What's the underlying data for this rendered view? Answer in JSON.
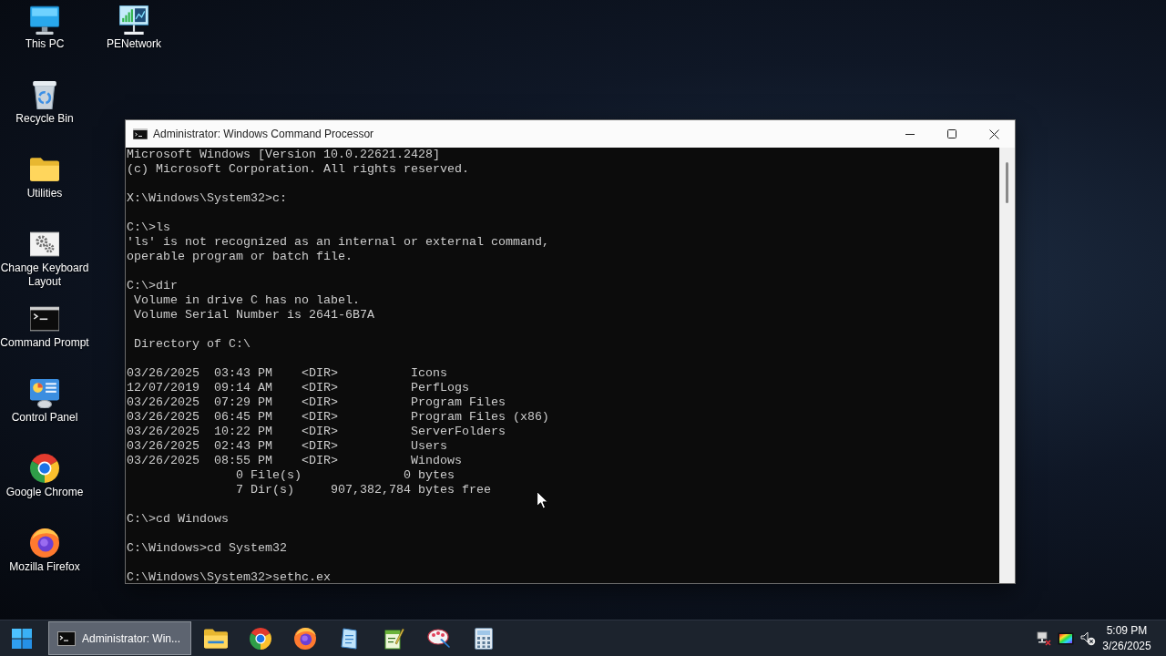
{
  "desktop": {
    "icons": [
      {
        "label": "This PC",
        "kind": "monitor"
      },
      {
        "label": "Recycle Bin",
        "kind": "recycle-bin"
      },
      {
        "label": "Utilities",
        "kind": "folder"
      },
      {
        "label": "Change Keyboard Layout",
        "kind": "gears"
      },
      {
        "label": "Command Prompt",
        "kind": "console"
      },
      {
        "label": "Control Panel",
        "kind": "control-panel"
      },
      {
        "label": "Google Chrome",
        "kind": "chrome"
      },
      {
        "label": "Mozilla Firefox",
        "kind": "firefox"
      },
      {
        "label": "PENetwork",
        "kind": "network"
      }
    ]
  },
  "window": {
    "title": "Administrator: Windows Command Processor",
    "console": {
      "blocks": [
        {
          "kind": "lines",
          "lines": [
            "Microsoft Windows [Version 10.0.22621.2428]",
            "(c) Microsoft Corporation. All rights reserved."
          ]
        },
        {
          "kind": "lines",
          "lines": [
            "X:\\Windows\\System32>c:"
          ]
        },
        {
          "kind": "lines",
          "lines": [
            "C:\\>ls",
            "'ls' is not recognized as an internal or external command,",
            "operable program or batch file."
          ]
        },
        {
          "kind": "lines",
          "lines": [
            "C:\\>dir",
            " Volume in drive C has no label.",
            " Volume Serial Number is 2641-6B7A"
          ]
        },
        {
          "kind": "lines",
          "lines": [
            " Directory of C:\\"
          ]
        },
        {
          "kind": "listing",
          "entries": [
            {
              "date": "03/26/2025",
              "time": "03:43 PM",
              "type": "<DIR>",
              "name": "Icons"
            },
            {
              "date": "12/07/2019",
              "time": "09:14 AM",
              "type": "<DIR>",
              "name": "PerfLogs"
            },
            {
              "date": "03/26/2025",
              "time": "07:29 PM",
              "type": "<DIR>",
              "name": "Program Files"
            },
            {
              "date": "03/26/2025",
              "time": "06:45 PM",
              "type": "<DIR>",
              "name": "Program Files (x86)"
            },
            {
              "date": "03/26/2025",
              "time": "10:22 PM",
              "type": "<DIR>",
              "name": "ServerFolders"
            },
            {
              "date": "03/26/2025",
              "time": "02:43 PM",
              "type": "<DIR>",
              "name": "Users"
            },
            {
              "date": "03/26/2025",
              "time": "08:55 PM",
              "type": "<DIR>",
              "name": "Windows"
            }
          ],
          "summary": [
            {
              "count": "0 File(s)",
              "total": "0 bytes"
            },
            {
              "count": "7 Dir(s)",
              "total": "907,382,784 bytes free"
            }
          ]
        },
        {
          "kind": "lines",
          "lines": [
            "C:\\>cd Windows"
          ]
        },
        {
          "kind": "lines",
          "lines": [
            "C:\\Windows>cd System32"
          ]
        },
        {
          "kind": "lines",
          "lines": [
            "C:\\Windows\\System32>sethc.ex"
          ]
        }
      ]
    }
  },
  "taskbar": {
    "tasks": [
      {
        "label": "Administrator: Win...",
        "selected": true
      }
    ],
    "clock": {
      "time": "5:09 PM",
      "date": "3/26/2025"
    }
  }
}
